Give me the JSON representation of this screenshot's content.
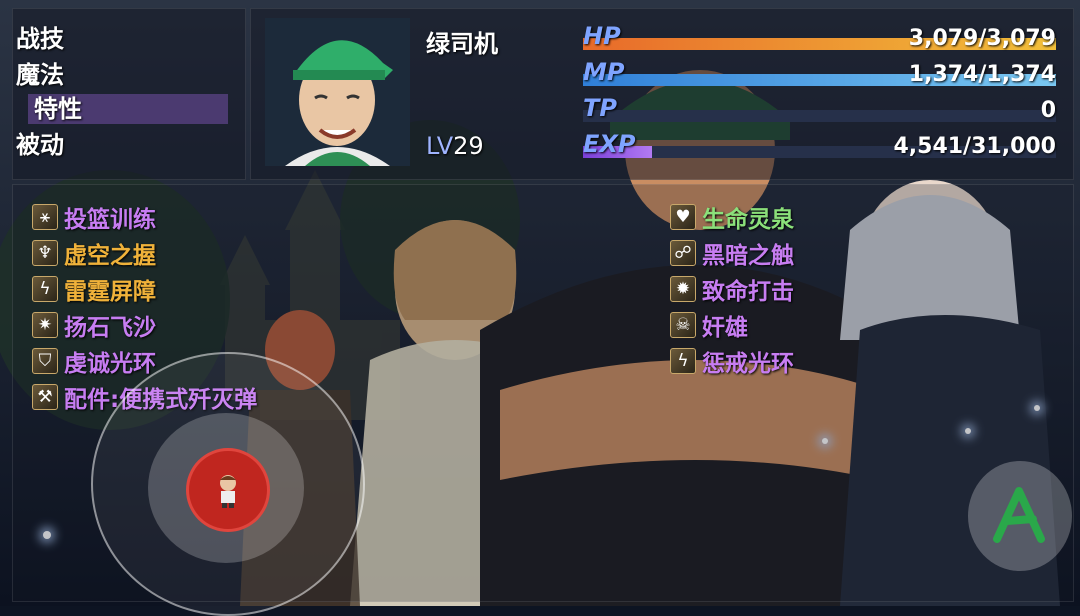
{
  "menu": {
    "items": [
      {
        "label": "战技"
      },
      {
        "label": "魔法"
      },
      {
        "label": "特性"
      },
      {
        "label": "被动"
      }
    ],
    "selected_index": 2
  },
  "actor": {
    "name": "绿司机",
    "level_label": "LV",
    "level": "29"
  },
  "stats": {
    "hp": {
      "label": "HP",
      "value": "3,079/3,079",
      "fraction": 1.0,
      "color_from": "#e86a2a",
      "color_to": "#f2c03a"
    },
    "mp": {
      "label": "MP",
      "value": "1,374/1,374",
      "fraction": 1.0,
      "color_from": "#2f7fd8",
      "color_to": "#7ac8f2"
    },
    "tp": {
      "label": "TP",
      "value": "0",
      "fraction": 0.0,
      "color_from": "#3fa85a",
      "color_to": "#8be07a"
    },
    "exp": {
      "label": "EXP",
      "value": "4,541/31,000",
      "fraction": 0.146,
      "color_from": "#7a3fd8",
      "color_to": "#b27af2"
    }
  },
  "skills_left": [
    {
      "label": "投篮训练",
      "icon": "basketball-icon",
      "glyph": "⚹",
      "color": "#c77df2"
    },
    {
      "label": "虚空之握",
      "icon": "void-hand-icon",
      "glyph": "♆",
      "color": "#f0b23a"
    },
    {
      "label": "雷霆屏障",
      "icon": "lightning-shield-icon",
      "glyph": "ϟ",
      "color": "#f0b23a"
    },
    {
      "label": "扬石飞沙",
      "icon": "sandstorm-icon",
      "glyph": "✷",
      "color": "#c77df2"
    },
    {
      "label": "虔诚光环",
      "icon": "holy-shield-icon",
      "glyph": "⛉",
      "color": "#c77df2"
    },
    {
      "label": "配件:便携式歼灭弹",
      "icon": "grenade-icon",
      "glyph": "⚒",
      "color": "#c77df2"
    }
  ],
  "skills_right": [
    {
      "label": "生命灵泉",
      "icon": "heart-spring-icon",
      "glyph": "♥",
      "color": "#8be07a"
    },
    {
      "label": "黑暗之触",
      "icon": "dark-touch-icon",
      "glyph": "☍",
      "color": "#c77df2"
    },
    {
      "label": "致命打击",
      "icon": "critical-strike-icon",
      "glyph": "✹",
      "color": "#c77df2"
    },
    {
      "label": "奸雄",
      "icon": "skull-icon",
      "glyph": "☠",
      "color": "#c77df2"
    },
    {
      "label": "惩戒光环",
      "icon": "punish-aura-icon",
      "glyph": "ϟ",
      "color": "#c77df2"
    }
  ],
  "controls": {
    "action_button_label": "A"
  }
}
